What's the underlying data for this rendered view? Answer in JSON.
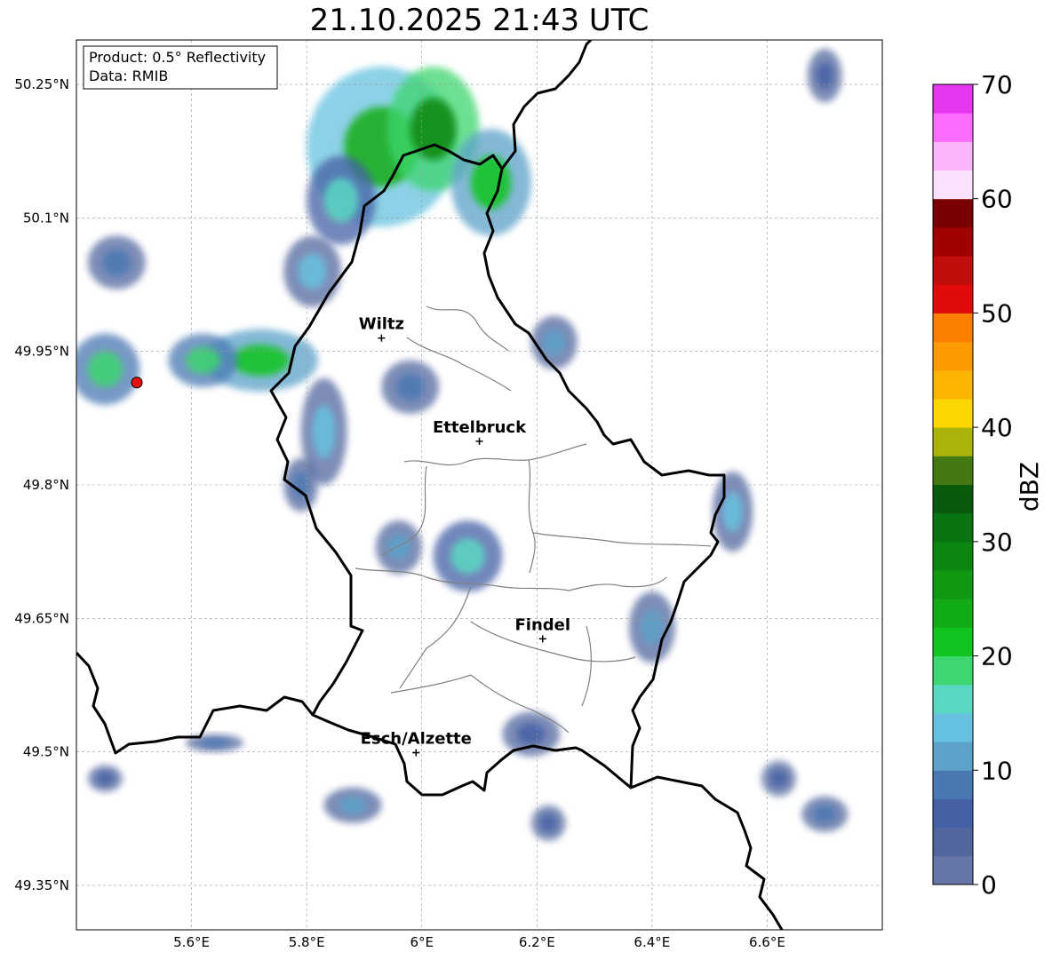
{
  "title": "21.10.2025 21:43 UTC",
  "info_box": {
    "product": "Product: 0.5° Reflectivity",
    "data_source": "Data: RMIB"
  },
  "axes": {
    "lon_range": [
      5.4,
      6.8
    ],
    "lat_range": [
      49.3,
      50.3
    ],
    "lon_ticks": [
      {
        "value": 5.6,
        "label": "5.6°E"
      },
      {
        "value": 5.8,
        "label": "5.8°E"
      },
      {
        "value": 6.0,
        "label": "6°E"
      },
      {
        "value": 6.2,
        "label": "6.2°E"
      },
      {
        "value": 6.4,
        "label": "6.4°E"
      },
      {
        "value": 6.6,
        "label": "6.6°E"
      }
    ],
    "lat_ticks": [
      {
        "value": 50.25,
        "label": "50.25°N"
      },
      {
        "value": 50.1,
        "label": "50.1°N"
      },
      {
        "value": 49.95,
        "label": "49.95°N"
      },
      {
        "value": 49.8,
        "label": "49.8°N"
      },
      {
        "value": 49.65,
        "label": "49.65°N"
      },
      {
        "value": 49.5,
        "label": "49.5°N"
      },
      {
        "value": 49.35,
        "label": "49.35°N"
      }
    ],
    "grid": true
  },
  "cities": [
    {
      "name": "Wiltz",
      "lon": 5.93,
      "lat": 49.965
    },
    {
      "name": "Ettelbruck",
      "lon": 6.1,
      "lat": 49.849
    },
    {
      "name": "Findel",
      "lon": 6.21,
      "lat": 49.627
    },
    {
      "name": "Esch/Alzette",
      "lon": 5.99,
      "lat": 49.499
    }
  ],
  "radar_site": {
    "lon": 5.505,
    "lat": 49.915,
    "color": "#e8110f"
  },
  "colorbar": {
    "label": "dBZ",
    "min": 0,
    "max": 70,
    "ticks": [
      {
        "value": 0,
        "label": "0"
      },
      {
        "value": 10,
        "label": "10"
      },
      {
        "value": 20,
        "label": "20"
      },
      {
        "value": 30,
        "label": "30"
      },
      {
        "value": 40,
        "label": "40"
      },
      {
        "value": 50,
        "label": "50"
      },
      {
        "value": 60,
        "label": "60"
      },
      {
        "value": 70,
        "label": "70"
      }
    ],
    "colors": [
      "#6676a8",
      "#53679f",
      "#4461a5",
      "#4a78b2",
      "#5ba1c9",
      "#66c2e0",
      "#5ad8c2",
      "#3ed66e",
      "#10c51f",
      "#12ad16",
      "#0f9a12",
      "#0b8711",
      "#0a7412",
      "#085b0a",
      "#437813",
      "#a9b30a",
      "#fcd701",
      "#fcb301",
      "#fc9a01",
      "#fc7f01",
      "#e10b0b",
      "#c20d0d",
      "#a00101",
      "#790101",
      "#fde2ff",
      "#fcb5fd",
      "#fc6dfd",
      "#e636ef"
    ]
  },
  "radar_echoes": [
    {
      "lon": 5.93,
      "lat": 50.18,
      "rlon": 0.13,
      "rlat": 0.09,
      "dbz": 24
    },
    {
      "lon": 6.02,
      "lat": 50.2,
      "rlon": 0.08,
      "rlat": 0.07,
      "dbz": 28
    },
    {
      "lon": 6.12,
      "lat": 50.14,
      "rlon": 0.07,
      "rlat": 0.06,
      "dbz": 21
    },
    {
      "lon": 5.86,
      "lat": 50.12,
      "rlon": 0.06,
      "rlat": 0.05,
      "dbz": 17
    },
    {
      "lon": 5.81,
      "lat": 50.04,
      "rlon": 0.05,
      "rlat": 0.04,
      "dbz": 14
    },
    {
      "lon": 5.72,
      "lat": 49.94,
      "rlon": 0.1,
      "rlat": 0.035,
      "dbz": 22
    },
    {
      "lon": 5.62,
      "lat": 49.94,
      "rlon": 0.06,
      "rlat": 0.03,
      "dbz": 18
    },
    {
      "lon": 5.45,
      "lat": 49.93,
      "rlon": 0.06,
      "rlat": 0.04,
      "dbz": 19
    },
    {
      "lon": 5.47,
      "lat": 50.05,
      "rlon": 0.05,
      "rlat": 0.03,
      "dbz": 9
    },
    {
      "lon": 5.83,
      "lat": 49.86,
      "rlon": 0.04,
      "rlat": 0.06,
      "dbz": 13
    },
    {
      "lon": 5.79,
      "lat": 49.8,
      "rlon": 0.03,
      "rlat": 0.03,
      "dbz": 8
    },
    {
      "lon": 5.96,
      "lat": 49.73,
      "rlon": 0.04,
      "rlat": 0.03,
      "dbz": 11
    },
    {
      "lon": 6.08,
      "lat": 49.72,
      "rlon": 0.06,
      "rlat": 0.04,
      "dbz": 15
    },
    {
      "lon": 5.98,
      "lat": 49.91,
      "rlon": 0.05,
      "rlat": 0.03,
      "dbz": 9
    },
    {
      "lon": 6.23,
      "lat": 49.96,
      "rlon": 0.04,
      "rlat": 0.03,
      "dbz": 10
    },
    {
      "lon": 6.54,
      "lat": 49.77,
      "rlon": 0.035,
      "rlat": 0.045,
      "dbz": 13
    },
    {
      "lon": 6.4,
      "lat": 49.64,
      "rlon": 0.04,
      "rlat": 0.04,
      "dbz": 10
    },
    {
      "lon": 6.19,
      "lat": 49.52,
      "rlon": 0.05,
      "rlat": 0.025,
      "dbz": 7
    },
    {
      "lon": 6.22,
      "lat": 49.42,
      "rlon": 0.03,
      "rlat": 0.02,
      "dbz": 6
    },
    {
      "lon": 5.88,
      "lat": 49.44,
      "rlon": 0.05,
      "rlat": 0.02,
      "dbz": 12
    },
    {
      "lon": 6.7,
      "lat": 49.43,
      "rlon": 0.04,
      "rlat": 0.02,
      "dbz": 9
    },
    {
      "lon": 6.62,
      "lat": 49.47,
      "rlon": 0.03,
      "rlat": 0.02,
      "dbz": 5
    },
    {
      "lon": 5.45,
      "lat": 49.47,
      "rlon": 0.03,
      "rlat": 0.015,
      "dbz": 5
    },
    {
      "lon": 5.64,
      "lat": 49.51,
      "rlon": 0.05,
      "rlat": 0.01,
      "dbz": 8
    },
    {
      "lon": 6.7,
      "lat": 50.26,
      "rlon": 0.03,
      "rlat": 0.03,
      "dbz": 6
    }
  ]
}
